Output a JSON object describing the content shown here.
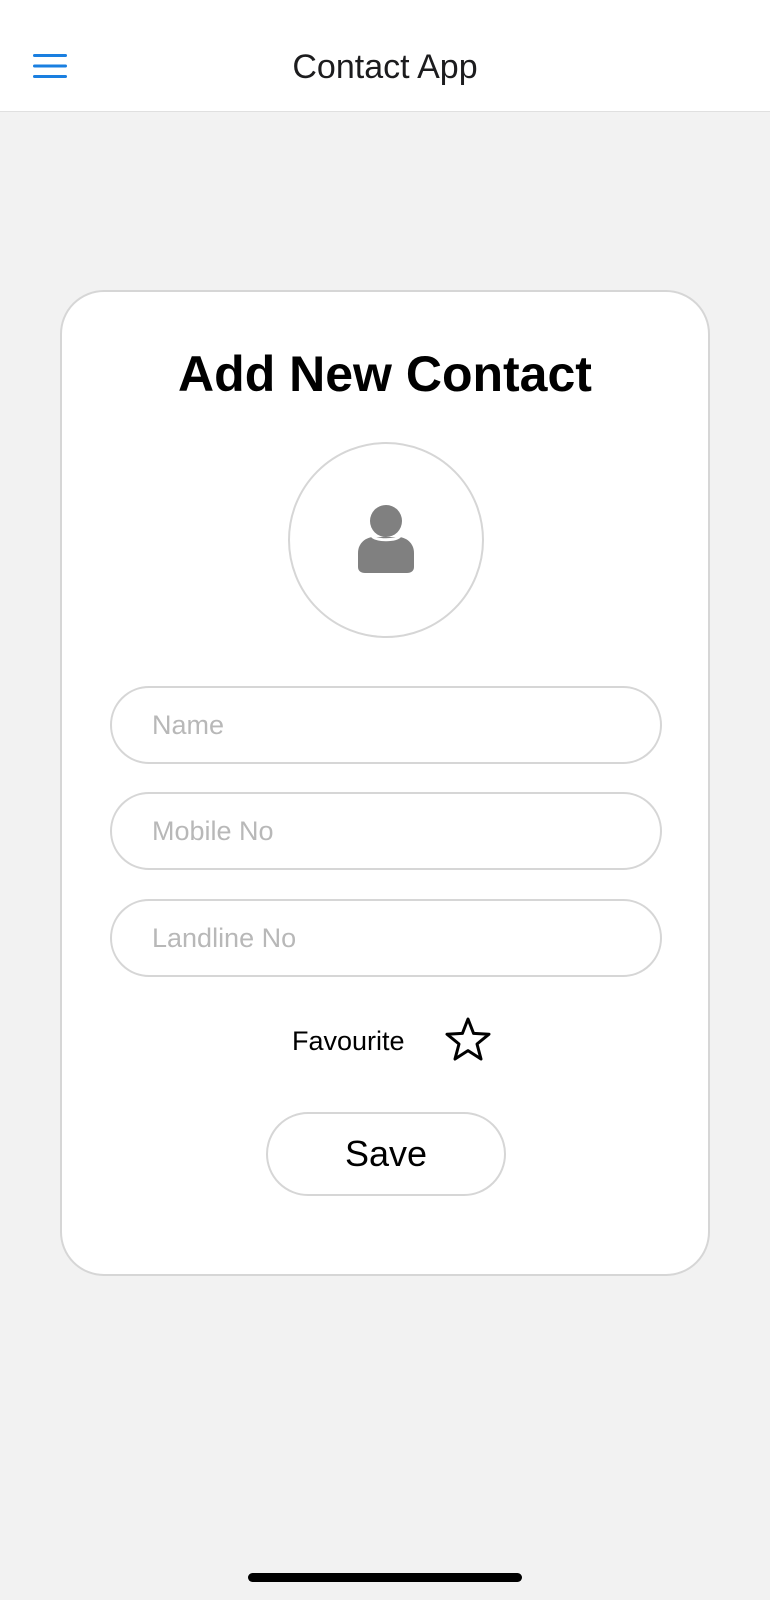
{
  "header": {
    "title": "Contact App",
    "menu_icon": "hamburger-menu-icon",
    "accent_color": "#1a7fe0"
  },
  "form": {
    "title": "Add New Contact",
    "avatar_icon": "person-icon",
    "name_placeholder": "Name",
    "mobile_placeholder": "Mobile No",
    "landline_placeholder": "Landline No",
    "name_value": "",
    "mobile_value": "",
    "landline_value": "",
    "favourite_label": "Favourite",
    "favourite_icon": "star-outline-icon",
    "favourite_selected": false,
    "save_label": "Save"
  }
}
